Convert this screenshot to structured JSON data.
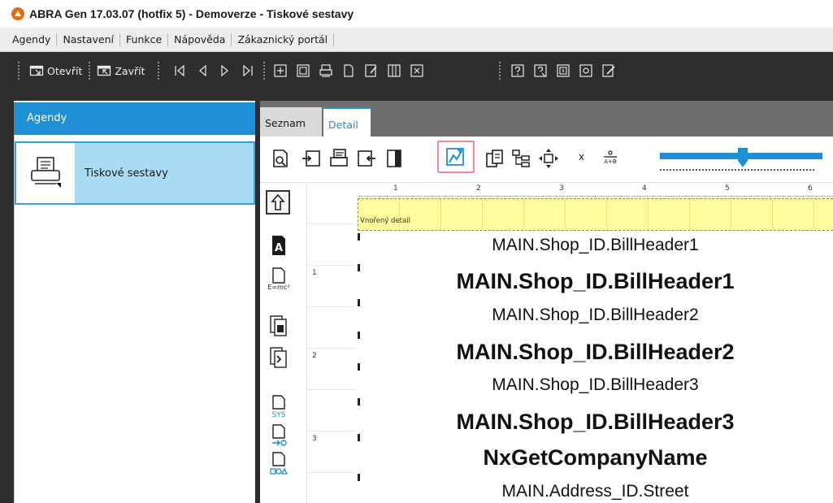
{
  "window": {
    "title": "ABRA Gen 17.03.07 (hotfix 5)  - Demoverze - Tiskové sestavy"
  },
  "menu": [
    "Agendy",
    "Nastavení",
    "Funkce",
    "Nápověda",
    "Zákaznický portál"
  ],
  "toolbar": {
    "open_label": "Otevřít",
    "close_label": "Zavřít"
  },
  "sidebar": {
    "header": "Agendy",
    "items": [
      {
        "label": "Tiskové sestavy",
        "icon": "printer-icon"
      }
    ]
  },
  "tabs": [
    {
      "label": "Seznam",
      "active": false
    },
    {
      "label": "Detail",
      "active": true
    }
  ],
  "report_toolbar": {
    "small_label": "x"
  },
  "ruler": {
    "horizontal": [
      "1",
      "2",
      "3",
      "4",
      "5",
      "6"
    ],
    "vertical": [
      "1",
      "2",
      "3"
    ]
  },
  "band": {
    "label": "Vnořený detail"
  },
  "fields": [
    {
      "text": "MAIN.Shop_ID.BillHeader1",
      "style": "normal"
    },
    {
      "text": "MAIN.Shop_ID.BillHeader1",
      "style": "bold"
    },
    {
      "text": "MAIN.Shop_ID.BillHeader2",
      "style": "normal"
    },
    {
      "text": "MAIN.Shop_ID.BillHeader2",
      "style": "bold"
    },
    {
      "text": "MAIN.Shop_ID.BillHeader3",
      "style": "normal"
    },
    {
      "text": "MAIN.Shop_ID.BillHeader3",
      "style": "bold"
    },
    {
      "text": "NxGetCompanyName",
      "style": "bold"
    },
    {
      "text": "MAIN.Address_ID.Street",
      "style": "normal"
    }
  ],
  "colors": {
    "accent": "#1f8fd6",
    "selected_agenda": "#a8dcf5",
    "band": "#fffd9e",
    "highlight_border": "#f08a94"
  }
}
